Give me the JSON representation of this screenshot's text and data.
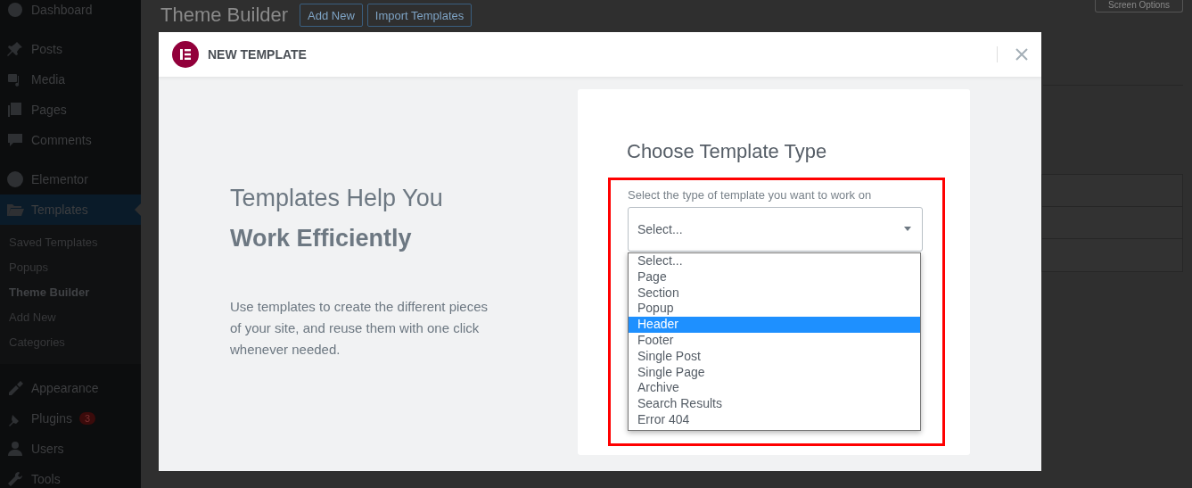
{
  "sidebar": {
    "items": [
      {
        "label": "Dashboard",
        "selected": false
      },
      {
        "label": "Posts",
        "selected": false
      },
      {
        "label": "Media",
        "selected": false
      },
      {
        "label": "Pages",
        "selected": false
      },
      {
        "label": "Comments",
        "selected": false
      },
      {
        "label": "Elementor",
        "selected": false
      },
      {
        "label": "Templates",
        "selected": true,
        "children": [
          {
            "label": "Saved Templates",
            "selected": false
          },
          {
            "label": "Popups",
            "selected": false
          },
          {
            "label": "Theme Builder",
            "selected": true
          },
          {
            "label": "Add New",
            "selected": false
          },
          {
            "label": "Categories",
            "selected": false
          }
        ]
      },
      {
        "label": "Appearance",
        "selected": false
      },
      {
        "label": "Plugins",
        "selected": false,
        "badge": "3"
      },
      {
        "label": "Users",
        "selected": false
      },
      {
        "label": "Tools",
        "selected": false
      }
    ]
  },
  "page": {
    "title": "Theme Builder",
    "buttons": [
      "Add New",
      "Import Templates"
    ],
    "screen_options": "Screen Options"
  },
  "modal": {
    "title": "NEW TEMPLATE",
    "intro": {
      "heading": "Templates Help You",
      "heading_bold": "Work Efficiently",
      "text": "Use templates to create the different pieces of your site, and reuse them with one click whenever needed."
    },
    "form": {
      "title": "Choose Template Type",
      "label": "Select the type of template you want to work on",
      "value": "Select...",
      "options": [
        {
          "label": "Select...",
          "highlighted": false
        },
        {
          "label": "Page",
          "highlighted": false
        },
        {
          "label": "Section",
          "highlighted": false
        },
        {
          "label": "Popup",
          "highlighted": false
        },
        {
          "label": "Header",
          "highlighted": true
        },
        {
          "label": "Footer",
          "highlighted": false
        },
        {
          "label": "Single Post",
          "highlighted": false
        },
        {
          "label": "Single Page",
          "highlighted": false
        },
        {
          "label": "Archive",
          "highlighted": false
        },
        {
          "label": "Search Results",
          "highlighted": false
        },
        {
          "label": "Error 404",
          "highlighted": false
        }
      ]
    }
  }
}
